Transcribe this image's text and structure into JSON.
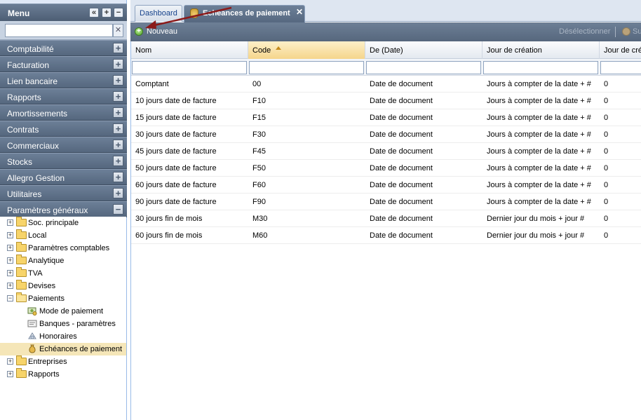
{
  "menu": {
    "title": "Menu",
    "header_buttons": [
      "«",
      "+",
      "−"
    ],
    "search_value": "",
    "search_clear": "✕",
    "sections": [
      {
        "label": "Comptabilité",
        "toggle": "+"
      },
      {
        "label": "Facturation",
        "toggle": "+"
      },
      {
        "label": "Lien bancaire",
        "toggle": "+"
      },
      {
        "label": "Rapports",
        "toggle": "+"
      },
      {
        "label": "Amortissements",
        "toggle": "+"
      },
      {
        "label": "Contrats",
        "toggle": "+"
      },
      {
        "label": "Commerciaux",
        "toggle": "+"
      },
      {
        "label": "Stocks",
        "toggle": "+"
      },
      {
        "label": "Allegro Gestion",
        "toggle": "+"
      },
      {
        "label": "Utilitaires",
        "toggle": "+"
      },
      {
        "label": "Paramètres généraux",
        "toggle": "−"
      }
    ],
    "tree": [
      {
        "label": "Soc. principale",
        "expander": "+",
        "icon": "folder-icon"
      },
      {
        "label": "Local",
        "expander": "+",
        "icon": "folder-icon"
      },
      {
        "label": "Paramètres comptables",
        "expander": "+",
        "icon": "folder-icon"
      },
      {
        "label": "Analytique",
        "expander": "+",
        "icon": "folder-icon"
      },
      {
        "label": "TVA",
        "expander": "+",
        "icon": "folder-icon"
      },
      {
        "label": "Devises",
        "expander": "+",
        "icon": "folder-icon"
      },
      {
        "label": "Paiements",
        "expander": "−",
        "icon": "folder-open-icon"
      },
      {
        "label": "Mode de paiement",
        "icon": "payment-mode-icon"
      },
      {
        "label": "Banques - paramètres",
        "icon": "bank-icon"
      },
      {
        "label": "Honoraires",
        "icon": "fees-icon"
      },
      {
        "label": "Echéances de paiement",
        "icon": "money-bag-icon",
        "selected": true
      },
      {
        "label": "Entreprises",
        "expander": "+",
        "icon": "folder-icon"
      },
      {
        "label": "Rapports",
        "expander": "+",
        "icon": "folder-icon"
      }
    ]
  },
  "tabs": {
    "dashboard": "Dashboard",
    "active": "Echéances de paiement",
    "close": "✕"
  },
  "toolbar": {
    "new_label": "Nouveau",
    "deselect_label": "Désélectionner",
    "delete_label": "Su"
  },
  "grid": {
    "columns": [
      "Nom",
      "Code",
      "De (Date)",
      "Jour de création",
      "Jour de cré"
    ],
    "sorted_column": "Code",
    "rows": [
      [
        "Comptant",
        "00",
        "Date de document",
        "Jours à compter de la date + #",
        "0"
      ],
      [
        "10 jours date de facture",
        "F10",
        "Date de document",
        "Jours à compter de la date + #",
        "0"
      ],
      [
        "15 jours date de facture",
        "F15",
        "Date de document",
        "Jours à compter de la date + #",
        "0"
      ],
      [
        "30 jours date de facture",
        "F30",
        "Date de document",
        "Jours à compter de la date + #",
        "0"
      ],
      [
        "45 jours date de facture",
        "F45",
        "Date de document",
        "Jours à compter de la date + #",
        "0"
      ],
      [
        "50  jours date de facture",
        "F50",
        "Date de document",
        "Jours à compter de la date + #",
        "0"
      ],
      [
        "60  jours date de facture",
        "F60",
        "Date de document",
        "Jours à compter de la date + #",
        "0"
      ],
      [
        "90 jours date de facture",
        "F90",
        "Date de document",
        "Jours à compter de la date + #",
        "0"
      ],
      [
        "30 jours fin de mois",
        "M30",
        "Date de document",
        "Dernier jour du mois + jour #",
        "0"
      ],
      [
        "60 jours fin de mois",
        "M60",
        "Date de document",
        "Dernier jour du mois + jour #",
        "0"
      ]
    ]
  },
  "colors": {
    "header_blue_gray": "#5e7088",
    "sorted_header": "#f5d58b",
    "selected_tree": "#f5e6b8",
    "annotation_arrow": "#8b1a1a"
  }
}
